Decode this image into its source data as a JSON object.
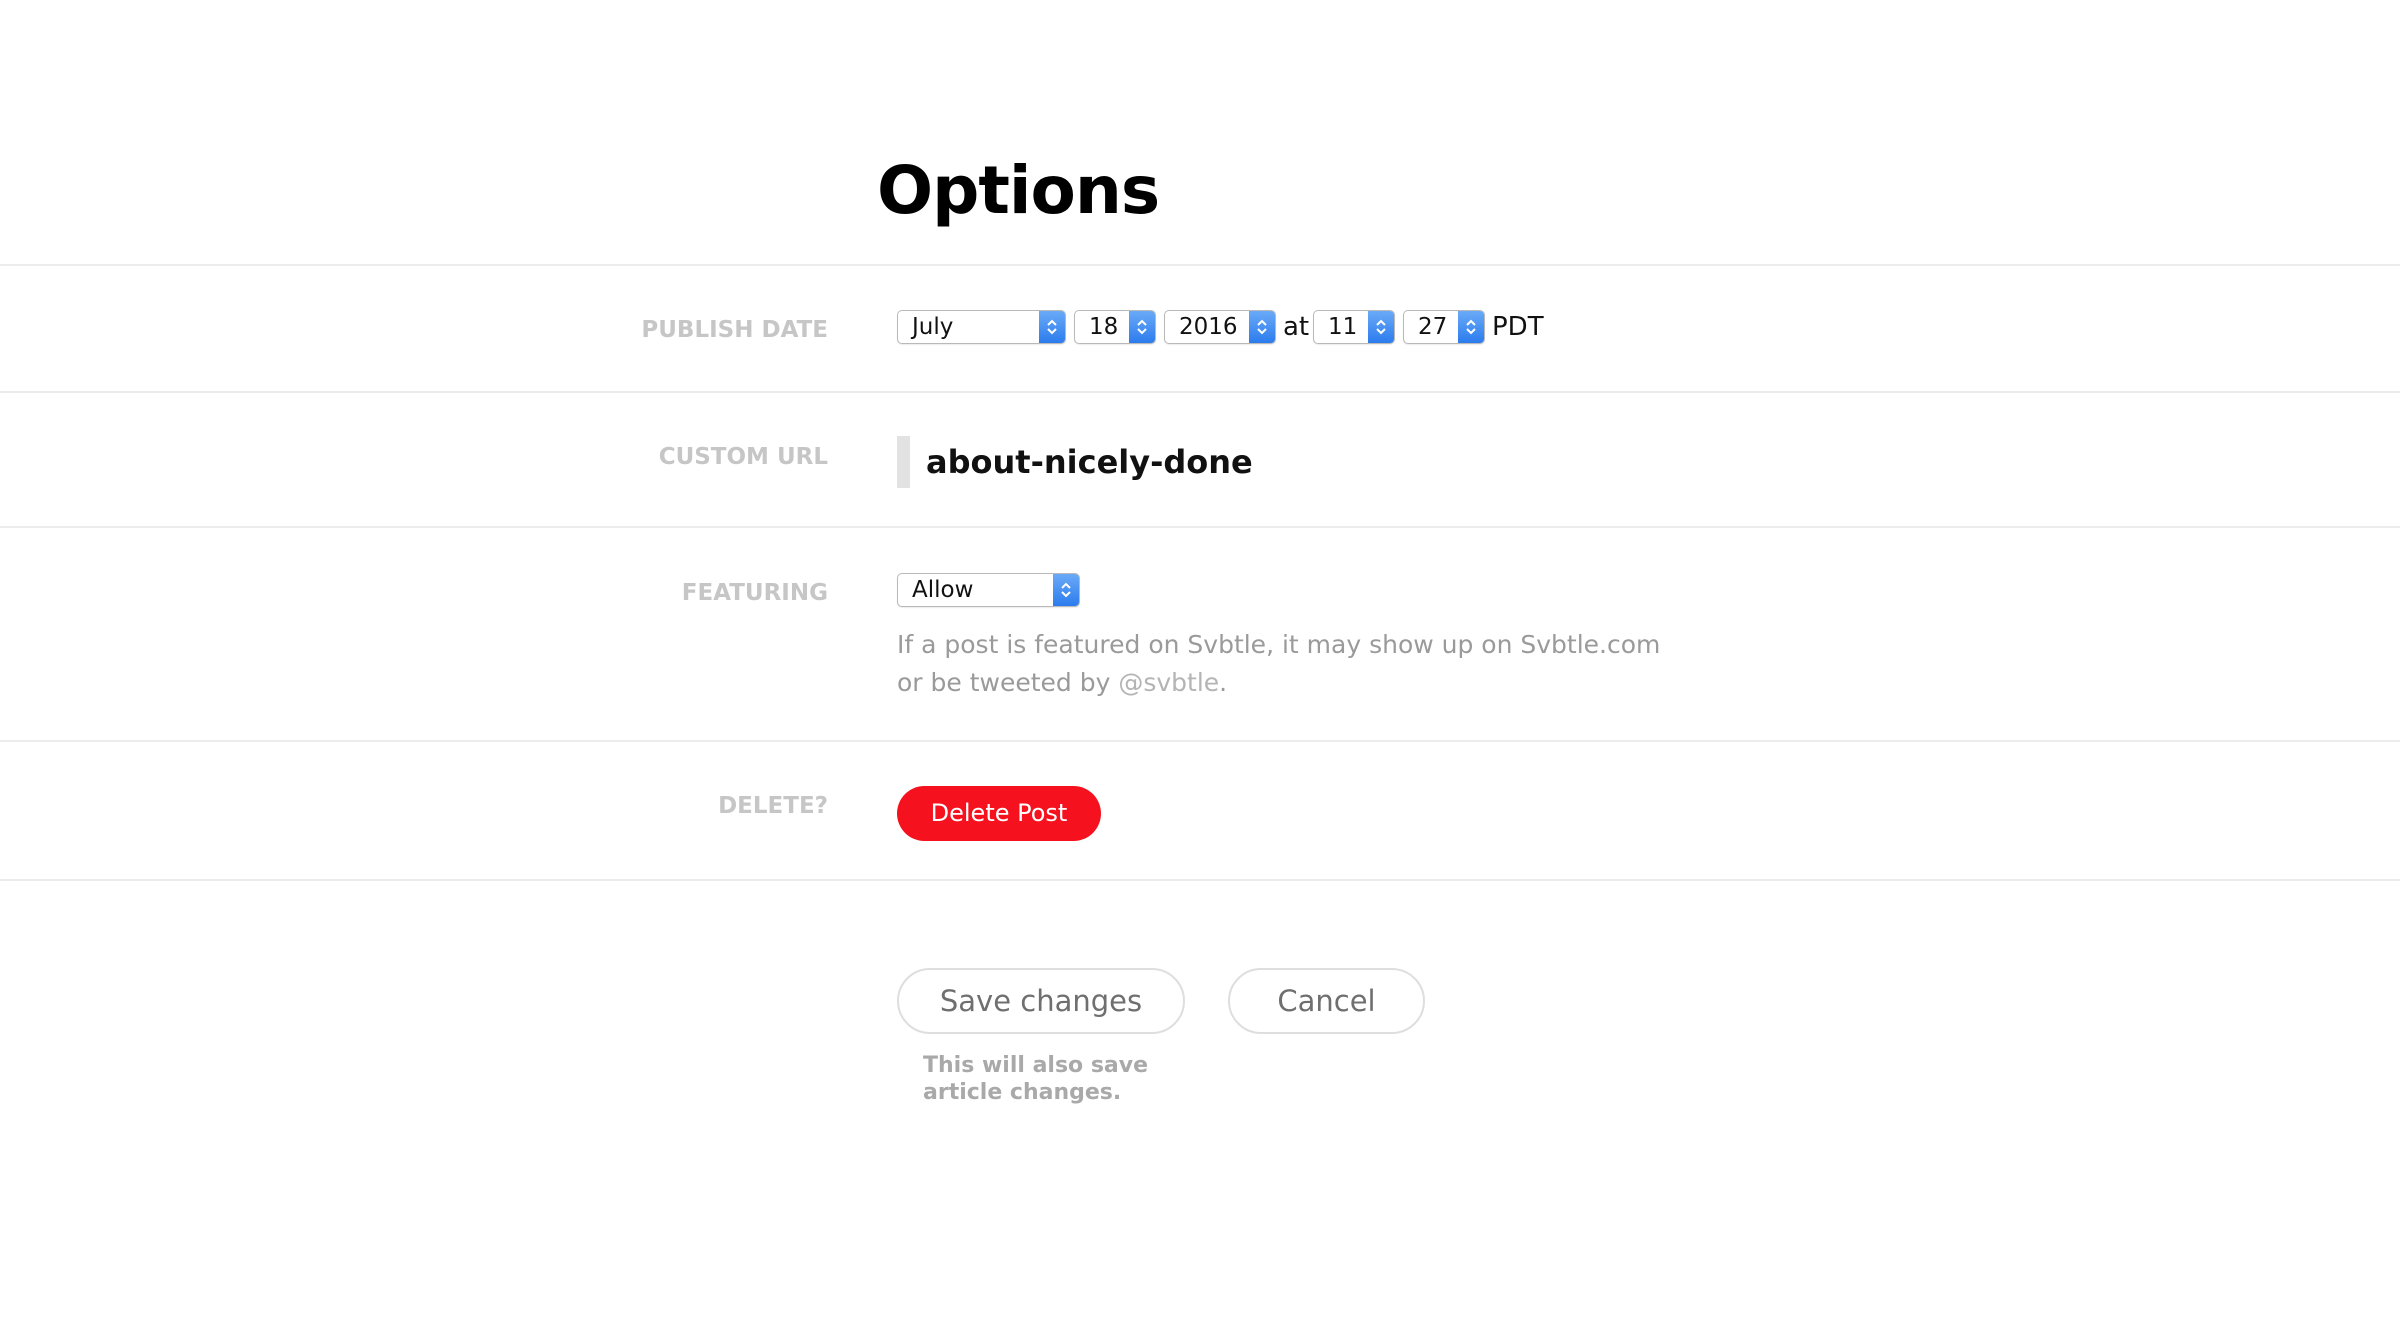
{
  "page": {
    "title": "Options"
  },
  "publish_date": {
    "label": "PUBLISH DATE",
    "month": "July",
    "day": "18",
    "year": "2016",
    "at_word": "at",
    "hour": "11",
    "minute": "27",
    "timezone": "PDT"
  },
  "custom_url": {
    "label": "CUSTOM URL",
    "value": "about-nicely-done"
  },
  "featuring": {
    "label": "FEATURING",
    "selected": "Allow",
    "help_prefix": "If a post is featured on Svbtle, it may show up on Svbtle.com or be tweeted by ",
    "help_handle": "@svbtle",
    "help_suffix": "."
  },
  "delete": {
    "label": "DELETE?",
    "button_label": "Delete Post",
    "button_color": "#f5111e"
  },
  "actions": {
    "save_label": "Save changes",
    "cancel_label": "Cancel",
    "save_note_line1": "This will also save",
    "save_note_line2": "article changes."
  },
  "icons": {
    "select_arrows": "updown-chevron-icon"
  },
  "colors": {
    "select_accent": "#2c7cee",
    "label_gray": "#c6c6c6",
    "help_gray": "#9a9a9a"
  }
}
